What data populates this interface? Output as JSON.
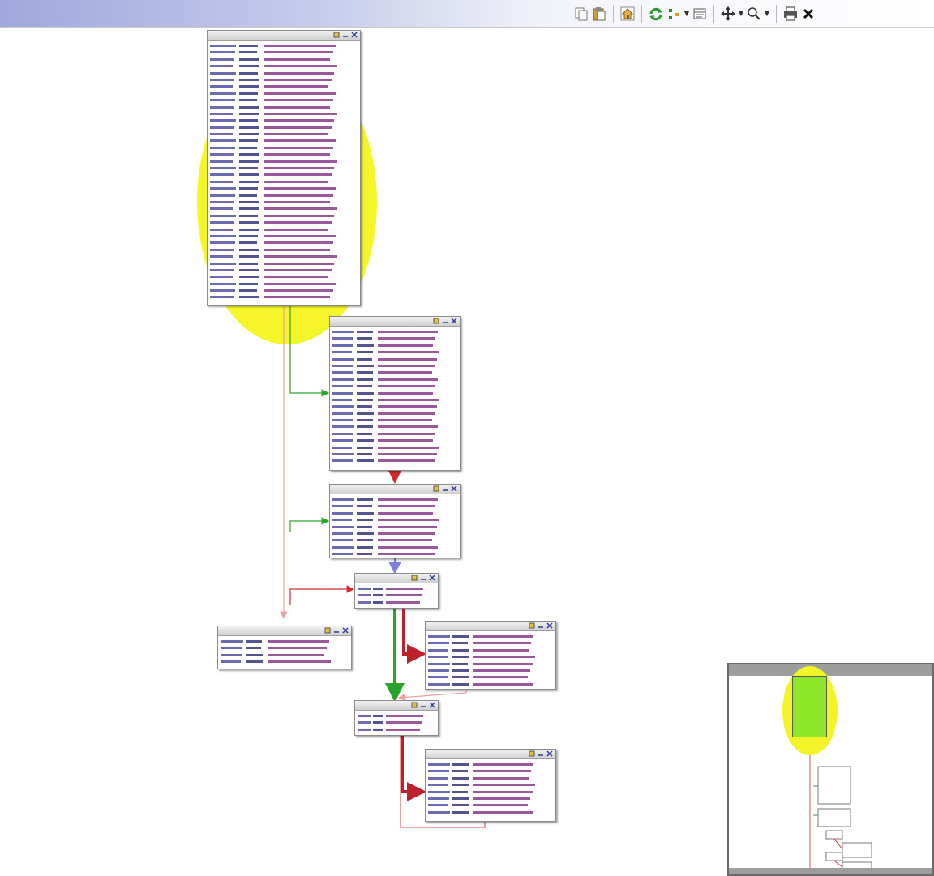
{
  "toolbar": {
    "buttons": [
      {
        "id": "copy",
        "icon": "copy-icon"
      },
      {
        "id": "paste",
        "icon": "paste-icon"
      },
      {
        "id": "home",
        "icon": "home-icon"
      },
      {
        "id": "refresh",
        "icon": "refresh-icon"
      },
      {
        "id": "layout",
        "icon": "layout-icon"
      },
      {
        "id": "display",
        "icon": "display-options-icon"
      },
      {
        "id": "move",
        "icon": "move-icon"
      },
      {
        "id": "zoom",
        "icon": "zoom-icon"
      },
      {
        "id": "print",
        "icon": "print-icon"
      },
      {
        "id": "close",
        "icon": "close-icon"
      }
    ]
  },
  "colors": {
    "highlight": "#f5f52a",
    "edge_true": "#2aa52a",
    "edge_false": "#d42a2a",
    "edge_uncond": "#f0a0a0",
    "edge_back": "#8080e0",
    "minimap_current": "#8ee62a"
  },
  "nodes": [
    {
      "id": "node-entry",
      "title": "",
      "lines": []
    },
    {
      "id": "node-block-2",
      "title": "",
      "lines": []
    },
    {
      "id": "node-block-3",
      "title": "",
      "lines": []
    },
    {
      "id": "node-block-4",
      "title": "",
      "lines": []
    },
    {
      "id": "node-block-5",
      "title": "",
      "lines": []
    },
    {
      "id": "node-block-6",
      "title": "",
      "lines": []
    },
    {
      "id": "node-block-7",
      "title": "",
      "lines": []
    },
    {
      "id": "node-block-8",
      "title": "",
      "lines": []
    }
  ]
}
